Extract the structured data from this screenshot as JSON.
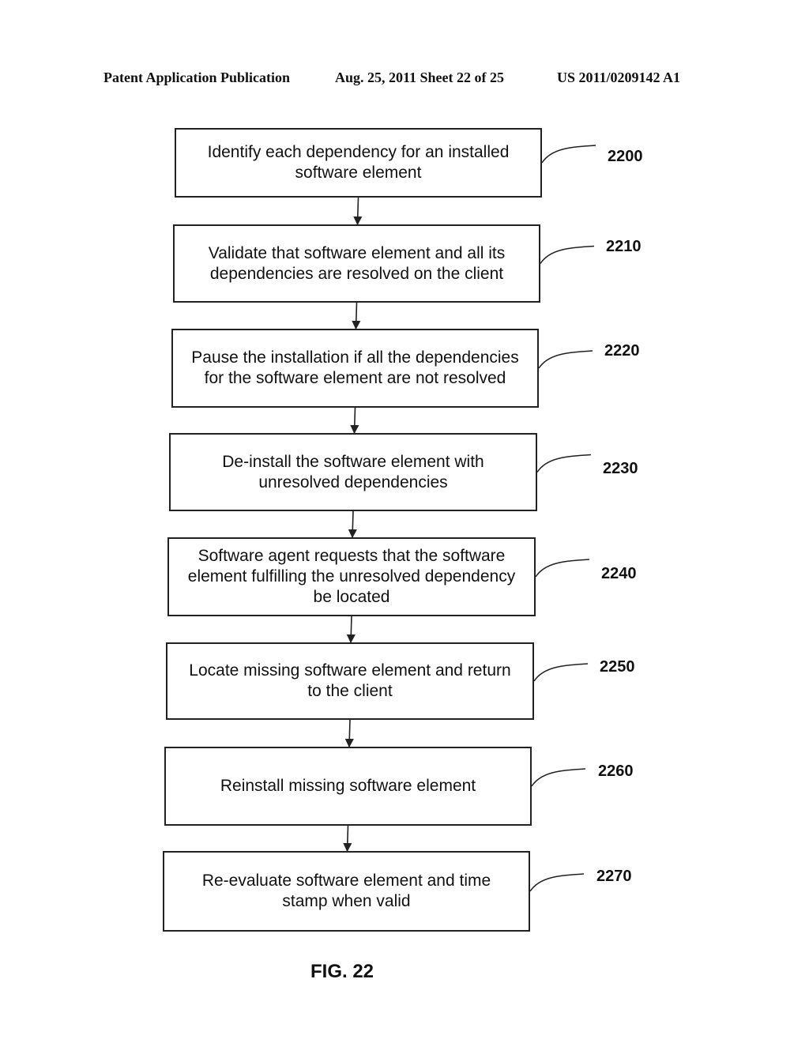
{
  "header": {
    "left": "Patent Application Publication",
    "middle": "Aug. 25, 2011  Sheet 22 of 25",
    "right": "US 2011/0209142 A1"
  },
  "steps": [
    {
      "ref": "2200",
      "text": "Identify each dependency for an installed\nsoftware element"
    },
    {
      "ref": "2210",
      "text": "Validate that software element and all its\ndependencies are resolved on the client"
    },
    {
      "ref": "2220",
      "text": "Pause the installation if all the dependencies\nfor the software element are not resolved"
    },
    {
      "ref": "2230",
      "text": "De-install the software element with\nunresolved dependencies"
    },
    {
      "ref": "2240",
      "text": "Software agent requests that the software\nelement fulfilling the unresolved dependency\nbe located"
    },
    {
      "ref": "2250",
      "text": "Locate missing software element and return\nto the client"
    },
    {
      "ref": "2260",
      "text": "Reinstall missing software element"
    },
    {
      "ref": "2270",
      "text": "Re-evaluate software element and time\nstamp when valid"
    }
  ],
  "figure_label": "FIG. 22"
}
